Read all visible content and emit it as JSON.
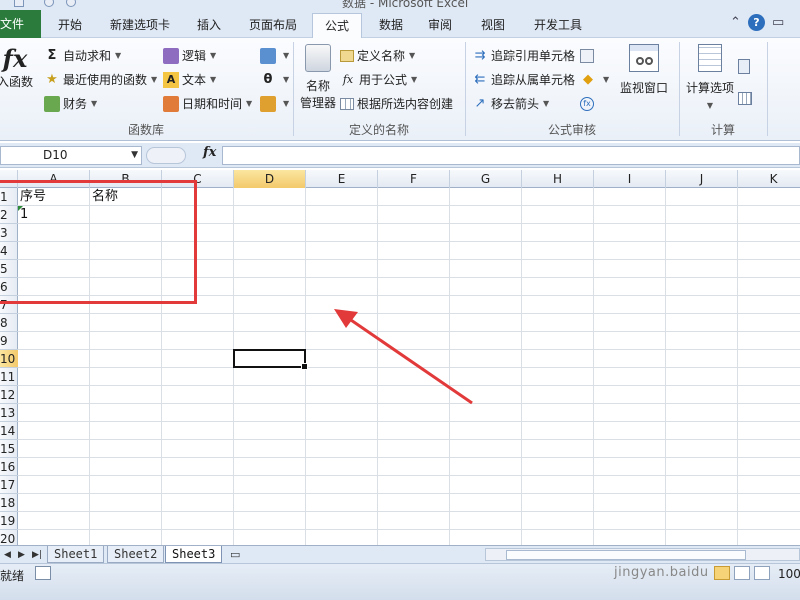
{
  "window": {
    "title": "数据 - Microsoft Excel"
  },
  "tabs": [
    "文件",
    "开始",
    "新建选项卡",
    "插入",
    "页面布局",
    "公式",
    "数据",
    "审阅",
    "视图",
    "开发工具"
  ],
  "active_tab": "公式",
  "ribbon": {
    "function_library": {
      "group_label": "函数库",
      "insert_function": "入函数",
      "insert_function_icon": "fx-icon",
      "autosum": "自动求和",
      "recently_used": "最近使用的函数",
      "financial": "财务",
      "logical": "逻辑",
      "text": "文本",
      "date_time": "日期和时间"
    },
    "defined_names": {
      "group_label": "定义的名称",
      "name_manager_line1": "名称",
      "name_manager_line2": "管理器",
      "define_name": "定义名称",
      "use_in_formula": "用于公式",
      "create_from_selection": "根据所选内容创建"
    },
    "formula_auditing": {
      "group_label": "公式审核",
      "trace_precedents": "追踪引用单元格",
      "trace_dependents": "追踪从属单元格",
      "remove_arrows": "移去箭头",
      "watch_window": "监视窗口"
    },
    "calculation": {
      "group_label": "计算",
      "calc_options": "计算选项"
    }
  },
  "formula_bar": {
    "name_box": "D10",
    "fx_label": "fx",
    "formula": ""
  },
  "columns": [
    "A",
    "B",
    "C",
    "D",
    "E",
    "F",
    "G",
    "H",
    "I",
    "J",
    "K"
  ],
  "selected_column": "D",
  "rows": [
    "1",
    "2",
    "3",
    "4",
    "5",
    "6",
    "7",
    "8",
    "9",
    "10",
    "11",
    "12",
    "13",
    "14",
    "15",
    "16",
    "17",
    "18",
    "19",
    "20"
  ],
  "selected_row": "10",
  "cells": {
    "A1": "序号",
    "B1": "名称",
    "A2": "1"
  },
  "active_cell": "D10",
  "sheets": [
    "Sheet1",
    "Sheet2",
    "Sheet3"
  ],
  "active_sheet": "Sheet3",
  "status": {
    "ready": "就绪",
    "zoom": "100"
  },
  "watermark": "jingyan.baidu",
  "annotation_color": "#e23a3a"
}
